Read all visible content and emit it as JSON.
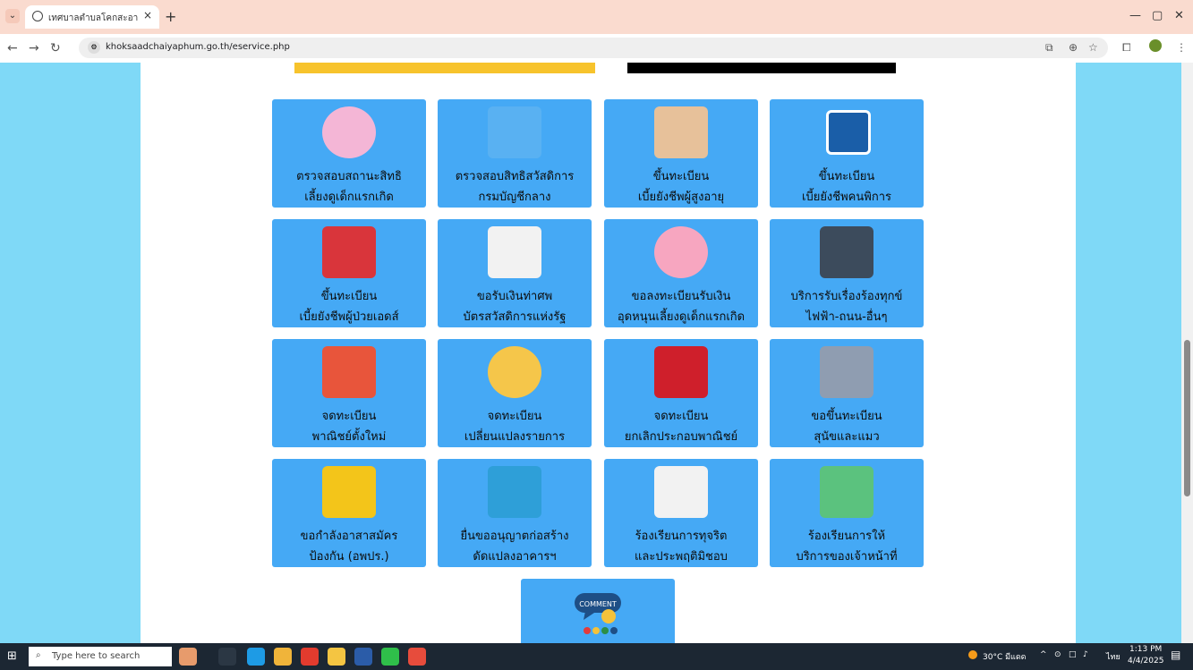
{
  "browser": {
    "tab_title": "เทศบาลตำบลโคกสะอาด อำเภอหนอง",
    "url": "khoksaadchaiyaphum.go.th/eservice.php"
  },
  "services": [
    {
      "line1": "ตรวจสอบสถานะสิทธิ",
      "line2": "เลี้ยงดูเด็กแรกเกิด",
      "icon": "mother-baby-icon",
      "color": "#f4b6d6"
    },
    {
      "line1": "ตรวจสอบสิทธิสวัสดิการ",
      "line2": "กรมบัญชีกลาง",
      "icon": "garuda-seal-icon",
      "color": "#67b7f0"
    },
    {
      "line1": "ขึ้นทะเบียน",
      "line2": "เบี้ยยังชีพผู้สูงอายุ",
      "icon": "elderly-couple-icon",
      "color": "#e7c19a"
    },
    {
      "line1": "ขึ้นทะเบียน",
      "line2": "เบี้ยยังชีพคนพิการ",
      "icon": "wheelchair-icon",
      "color": "#1a5ea8"
    },
    {
      "line1": "ขึ้นทะเบียน",
      "line2": "เบี้ยยังชีพผู้ป่วยเอดส์",
      "icon": "aids-ribbon-icon",
      "color": "#d9353b"
    },
    {
      "line1": "ขอรับเงินท่าศพ",
      "line2": "บัตรสวัสดิการแห่งรัฐ",
      "icon": "id-card-icon",
      "color": "#f2f2f2"
    },
    {
      "line1": "ขอลงทะเบียนรับเงิน",
      "line2": "อุดหนุนเลี้ยงดูเด็กแรกเกิด",
      "icon": "newborn-icon",
      "color": "#f7a6c0"
    },
    {
      "line1": "บริการรับเรื่องร้องทุกข์",
      "line2": "ไฟฟ้า-ถนน-อื่นๆ",
      "icon": "utilities-icon",
      "color": "#3c4b5c"
    },
    {
      "line1": "จดทะเบียน",
      "line2": "พาณิชย์ตั้งใหม่",
      "icon": "new-shop-icon",
      "color": "#e8553b"
    },
    {
      "line1": "จดทะเบียน",
      "line2": "เปลี่ยนแปลงรายการ",
      "icon": "store-change-icon",
      "color": "#f5c64a"
    },
    {
      "line1": "จดทะเบียน",
      "line2": "ยกเลิกประกอบพาณิชย์",
      "icon": "shop-cancelled-icon",
      "color": "#cf1f2b"
    },
    {
      "line1": "ขอขึ้นทะเบียน",
      "line2": "สุนัขและแมว",
      "icon": "pet-cat-icon",
      "color": "#8f9db1"
    },
    {
      "line1": "ขอกำลังอาสาสมัคร",
      "line2": "ป้องกัน (อพปร.)",
      "icon": "volunteer-emblem-icon",
      "color": "#f3c51a"
    },
    {
      "line1": "ยื่นขออนุญาตก่อสร้าง",
      "line2": "ดัดแปลงอาคารฯ",
      "icon": "buildings-icon",
      "color": "#2e9fd8"
    },
    {
      "line1": "ร้องเรียนการทุจริต",
      "line2": "และประพฤติมิชอบ",
      "icon": "no-corruption-icon",
      "color": "#f2f2f2"
    },
    {
      "line1": "ร้องเรียนการให้",
      "line2": "บริการของเจ้าหน้าที่",
      "icon": "chat-bubbles-icon",
      "color": "#5bc27e"
    }
  ],
  "comment_card": {
    "icon": "comment-icon",
    "color": "#1e4f86"
  },
  "taskbar": {
    "search_placeholder": "Type here to search",
    "weather": "30°C มีแดด",
    "lang": "ไทย",
    "time": "1:13 PM",
    "date": "4/4/2025"
  }
}
